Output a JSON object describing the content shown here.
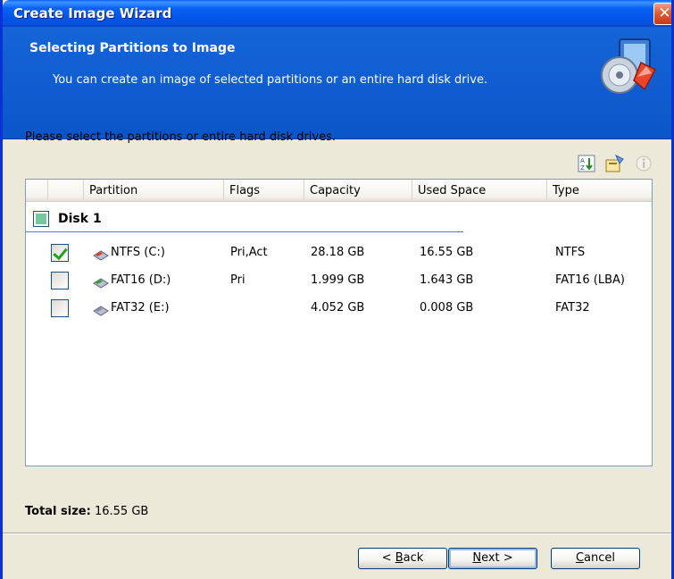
{
  "window": {
    "title": "Create Image Wizard",
    "close_glyph": "✕"
  },
  "header": {
    "heading": "Selecting Partitions to Image",
    "subheading": "You can create an image of selected partitions or an entire hard disk drive.",
    "icon": "disk-image-wizard-icon"
  },
  "main": {
    "instruction": "Please select the partitions or entire hard disk drives.",
    "toolbar_icons": [
      "sort-icon",
      "properties-icon",
      "info-icon"
    ],
    "columns": [
      "Partition",
      "Flags",
      "Capacity",
      "Used Space",
      "Type"
    ],
    "group": {
      "label": "Disk 1",
      "state": "partial"
    },
    "rows": [
      {
        "checked": true,
        "partition": "NTFS (C:)",
        "flags": "Pri,Act",
        "capacity": "28.18 GB",
        "used": "16.55 GB",
        "type": "NTFS",
        "icon_accent": "#e53b1f"
      },
      {
        "checked": false,
        "partition": "FAT16 (D:)",
        "flags": "Pri",
        "capacity": "1.999 GB",
        "used": "1.643 GB",
        "type": "FAT16 (LBA)",
        "icon_accent": "#2fa52f"
      },
      {
        "checked": false,
        "partition": "FAT32 (E:)",
        "flags": "",
        "capacity": "4.052 GB",
        "used": "0.008 GB",
        "type": "FAT32",
        "icon_accent": "#8a8fa8"
      }
    ]
  },
  "footer": {
    "total_label": "Total size:",
    "total_value": "16.55 GB",
    "back_prefix": "< ",
    "back_key": "B",
    "back_rest": "ack",
    "next_key": "N",
    "next_rest": "ext >",
    "cancel_key": "C",
    "cancel_rest": "ancel"
  },
  "colors": {
    "title_bar": "#0a5ef7",
    "header_band": "#0a56c9",
    "checkmark": "#21a121"
  }
}
